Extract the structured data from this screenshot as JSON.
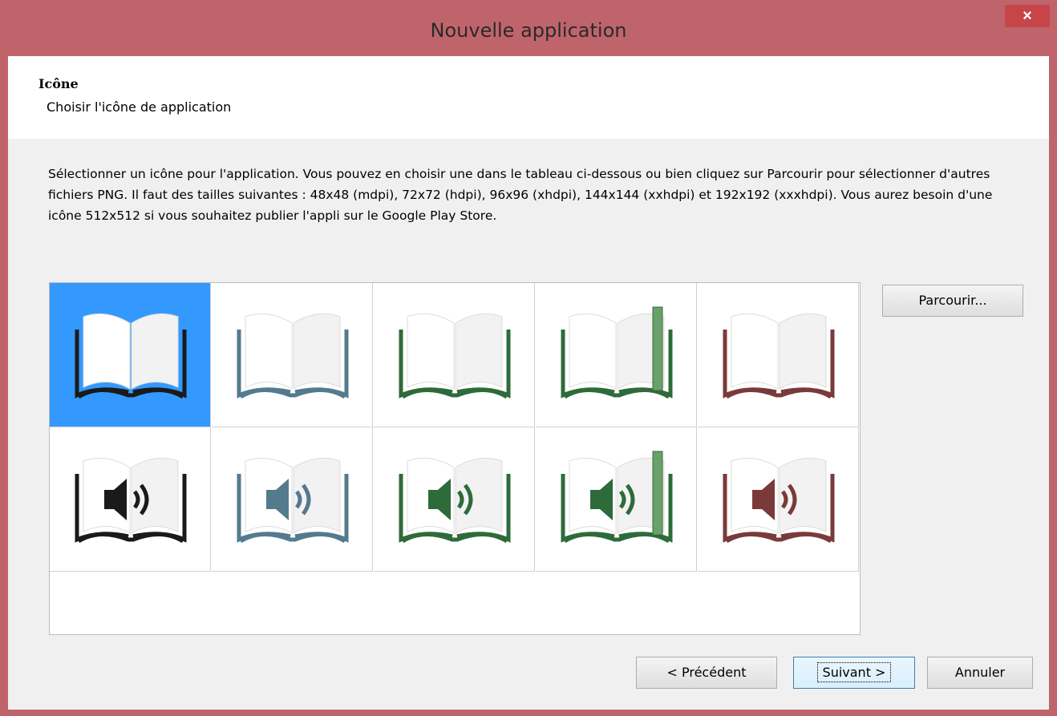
{
  "window": {
    "title": "Nouvelle application",
    "close_glyph": "×"
  },
  "header": {
    "title": "Icône",
    "subtitle": "Choisir l'icône de application"
  },
  "description": "Sélectionner un icône pour l'application. Vous pouvez en choisir une dans le tableau ci-dessous ou bien cliquez sur Parcourir pour sélectionner d'autres fichiers PNG. Il faut des tailles suivantes : 48x48 (mdpi), 72x72 (hdpi), 96x96 (xhdpi), 144x144 (xxhdpi) et 192x192 (xxxhdpi). Vous aurez besoin d'une icône 512x512 si vous souhaitez publier l'appli sur le Google Play Store.",
  "buttons": {
    "browse": "Parcourir...",
    "previous": "< Précédent",
    "next": "Suivant >",
    "cancel": "Annuler"
  },
  "icons": [
    {
      "name": "book-black-icon",
      "type": "book",
      "color": "#1a1a1a",
      "selected": true
    },
    {
      "name": "book-blue-icon",
      "type": "book",
      "color": "#557a8e",
      "selected": false
    },
    {
      "name": "book-green-icon",
      "type": "book",
      "color": "#2e6b3a",
      "selected": false
    },
    {
      "name": "book-green-bookmark-icon",
      "type": "book-bookmark",
      "color": "#2e6b3a",
      "selected": false
    },
    {
      "name": "book-red-icon",
      "type": "book",
      "color": "#7a3a3a",
      "selected": false
    },
    {
      "name": "audiobook-black-icon",
      "type": "audio",
      "color": "#1a1a1a",
      "selected": false
    },
    {
      "name": "audiobook-blue-icon",
      "type": "audio",
      "color": "#557a8e",
      "selected": false
    },
    {
      "name": "audiobook-green-icon",
      "type": "audio",
      "color": "#2e6b3a",
      "selected": false
    },
    {
      "name": "audiobook-green-bookmark-icon",
      "type": "audio-bookmark",
      "color": "#2e6b3a",
      "selected": false
    },
    {
      "name": "audiobook-red-icon",
      "type": "audio",
      "color": "#7a3a3a",
      "selected": false
    }
  ]
}
